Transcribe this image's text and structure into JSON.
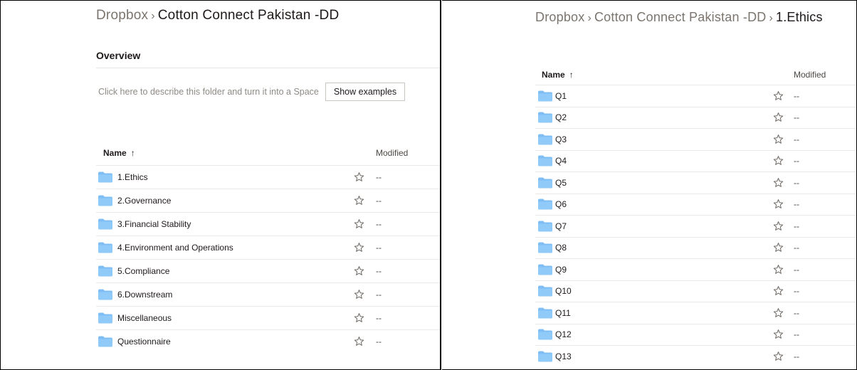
{
  "left": {
    "breadcrumb": {
      "root": "Dropbox",
      "separator": "›",
      "current": "Cotton Connect Pakistan -DD"
    },
    "overview": {
      "title": "Overview",
      "description_prompt": "Click here to describe this folder and turn it into a Space",
      "show_examples_label": "Show examples"
    },
    "columns": {
      "name": "Name",
      "sort_indicator": "↑",
      "modified": "Modified"
    },
    "rows": [
      {
        "name": "1.Ethics",
        "modified": "--"
      },
      {
        "name": "2.Governance",
        "modified": "--"
      },
      {
        "name": "3.Financial Stability",
        "modified": "--"
      },
      {
        "name": "4.Environment and Operations",
        "modified": "--"
      },
      {
        "name": "5.Compliance",
        "modified": "--"
      },
      {
        "name": "6.Downstream",
        "modified": "--"
      },
      {
        "name": "Miscellaneous",
        "modified": "--"
      },
      {
        "name": "Questionnaire",
        "modified": "--"
      }
    ]
  },
  "right": {
    "breadcrumb": {
      "root": "Dropbox",
      "separator": "›",
      "middle": "Cotton Connect Pakistan -DD",
      "current": "1.Ethics"
    },
    "columns": {
      "name": "Name",
      "sort_indicator": "↑",
      "modified": "Modified"
    },
    "rows": [
      {
        "name": "Q1",
        "modified": "--"
      },
      {
        "name": "Q2",
        "modified": "--"
      },
      {
        "name": "Q3",
        "modified": "--"
      },
      {
        "name": "Q4",
        "modified": "--"
      },
      {
        "name": "Q5",
        "modified": "--"
      },
      {
        "name": "Q6",
        "modified": "--"
      },
      {
        "name": "Q7",
        "modified": "--"
      },
      {
        "name": "Q8",
        "modified": "--"
      },
      {
        "name": "Q9",
        "modified": "--"
      },
      {
        "name": "Q10",
        "modified": "--"
      },
      {
        "name": "Q11",
        "modified": "--"
      },
      {
        "name": "Q12",
        "modified": "--"
      },
      {
        "name": "Q13",
        "modified": "--"
      }
    ]
  },
  "colors": {
    "folder": "#90caf9",
    "folder_tab": "#7fbef5",
    "muted_text": "#7b756e",
    "divider": "#ebe9e6"
  },
  "icons": {
    "folder": "folder-icon",
    "star": "star-icon",
    "sort": "sort-ascending-icon"
  }
}
